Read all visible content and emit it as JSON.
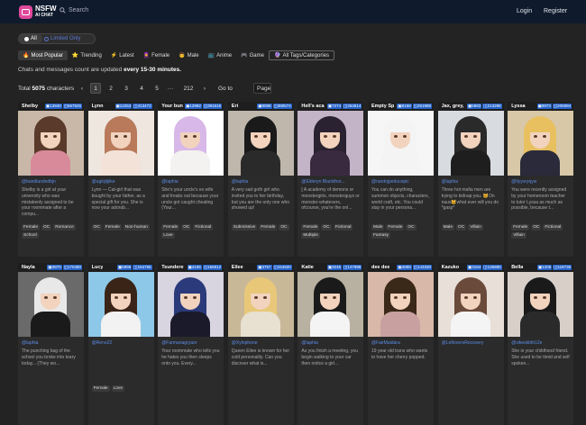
{
  "header": {
    "brand_top": "NSFW",
    "brand_bottom": "AI CHAT",
    "search_label": "Search",
    "login": "Login",
    "register": "Register"
  },
  "filters": {
    "all": "All",
    "limited_only": "Limited Only"
  },
  "tabs": [
    {
      "label": "Most Popular",
      "icon": "🔥"
    },
    {
      "label": "Trending",
      "icon": "⭐"
    },
    {
      "label": "Latest",
      "icon": "⚡"
    },
    {
      "label": "Female",
      "icon": "🧕"
    },
    {
      "label": "Male",
      "icon": "👨"
    },
    {
      "label": "Anime",
      "icon": "📺"
    },
    {
      "label": "Game",
      "icon": "🎮"
    },
    {
      "label": "All Tags/Categories",
      "icon": "🔮"
    }
  ],
  "notice": {
    "text": "Chats and messages count are updated",
    "bold": "every 15-30 minutes."
  },
  "pagination": {
    "total_prefix": "Total",
    "total_count": "5075",
    "total_suffix": "characters",
    "prev": "‹",
    "pages": [
      "1",
      "2",
      "3",
      "4",
      "5"
    ],
    "ellipsis": "···",
    "last": "212",
    "next": "›",
    "goto_label": "Go to",
    "page_label": "Page"
  },
  "cards": [
    {
      "name": "Shelby",
      "chats": "13940",
      "msgs": "567526",
      "author": "@bandlandndbjn",
      "desc": "Shelby is a girl at your university who was mistakenly assigned to be your roommate after a compu...",
      "tags": [
        "Female",
        "OC",
        "Romance",
        "School"
      ],
      "hair": "#5a3a2a",
      "body": "#d88a9a",
      "bg": "#c9b8a8"
    },
    {
      "name": "Lynn",
      "chats": "12253",
      "msgs": "413472",
      "author": "@ugiiijiijiike",
      "desc": "Lynn — Cat-girl that was bought by your father, as a special gift for you. She is now your adorab...",
      "tags": [
        "OC",
        "Female",
        "Non-human"
      ],
      "hair": "#b87a5a",
      "body": "#f2e2d8",
      "bg": "#efe6e0"
    },
    {
      "name": "Your bun",
      "chats": "12992",
      "msgs": "391616",
      "author": "@laphia",
      "desc": "She's your uncle's ex wife and freaks out because your uncle got caught cheating (Your...",
      "tags": [
        "Female",
        "OC",
        "Fictional",
        "Love"
      ],
      "hair": "#d8b8e8",
      "body": "#f4f2f0",
      "bg": "#ffffff"
    },
    {
      "name": "Eri",
      "chats": "9088",
      "msgs": "380574",
      "author": "@laphia",
      "desc": "A very sad goth girl who invited you to her birthday, but you are the only one who showed up!",
      "tags": [
        "Submissive",
        "Female",
        "OC"
      ],
      "hair": "#1a1a1a",
      "body": "#2a2a2a",
      "bg": "#bfb6ac"
    },
    {
      "name": "Hell's aca",
      "chats": "7274",
      "msgs": "264614",
      "author": "@Elderyn Blackthor...",
      "desc": "[ A academy of demons or monstergirls, monsterguys or monster-whatevers, ofcourse, you're the onl...",
      "tags": [
        "Female",
        "OC",
        "Fictional",
        "Multiple"
      ],
      "hair": "#2a2230",
      "body": "#3a2a40",
      "bg": "#c4b4c8"
    },
    {
      "name": "Empty Sp",
      "chats": "6168",
      "msgs": "251988",
      "author": "@randojpeducepic",
      "desc": "You can do anything, summon objects, characters, world craft, etc. You could stay in your persona...",
      "tags": [
        "Male",
        "Female",
        "OC",
        "Fantasy"
      ],
      "hair": "#f4f4f4",
      "body": "#f4f4f4",
      "bg": "#f6f6f6"
    },
    {
      "name": "Jax, grey,",
      "chats": "5983",
      "msgs": "213298",
      "author": "@laphia",
      "desc": "Three hot mafia men are trying to kidnap you. 🐱On naux🐱what ever will you do *gasp*",
      "tags": [
        "Male",
        "OC",
        "Villain"
      ],
      "hair": "#2a2a2a",
      "body": "#1e1e1e",
      "bg": "#d8dce0"
    },
    {
      "name": "Lyssa",
      "chats": "9973",
      "msgs": "205994",
      "author": "@Ilyyvryqyw",
      "desc": "You were recently assigned by your homeroom teacher to tutor Lyssa as much as possible, because t...",
      "tags": [
        "Female",
        "OC",
        "Fictional",
        "Villain"
      ],
      "hair": "#e8c060",
      "body": "#2a2a3a",
      "bg": "#d8c8a8"
    },
    {
      "name": "Nayla",
      "chats": "3870",
      "msgs": "170480",
      "author": "@laphia",
      "desc": "The punching bag of the school you broke into teary today... (They wo...",
      "tags": [],
      "hair": "#e8e8e8",
      "body": "#1a1a1a",
      "bg": "#6a6a6a"
    },
    {
      "name": "Lucy",
      "chats": "5996",
      "msgs": "164766",
      "author": "@Reno22",
      "desc": "",
      "tags": [
        "Female",
        "Love"
      ],
      "hair": "#3a2418",
      "body": "#f2f2f2",
      "bg": "#8ec8e8"
    },
    {
      "name": "Tsundere",
      "chats": "4196",
      "msgs": "156912",
      "author": "@Farmanagryaor",
      "desc": "Your roommate who tells you he hates you then sleeps onto you. Every...",
      "tags": [],
      "hair": "#2a3a7a",
      "body": "#1a1a2a",
      "bg": "#d8d4e0"
    },
    {
      "name": "Eilee",
      "chats": "3757",
      "msgs": "154920",
      "author": "@Xylophone",
      "desc": "Queen Eilee is known for her cold personality. Can you discover what is...",
      "tags": [],
      "hair": "#e8c878",
      "body": "#e8e0d0",
      "bg": "#c8b898"
    },
    {
      "name": "Katie",
      "chats": "3246",
      "msgs": "147998",
      "author": "@laphia",
      "desc": "As you finish a meeting, you begin walking to your car then notice a girl...",
      "tags": [],
      "hair": "#1a1a1a",
      "body": "#f4f4f4",
      "bg": "#b8b0a0"
    },
    {
      "name": "dee dee",
      "chats": "4898",
      "msgs": "143330",
      "author": "@FairMaidara",
      "desc": "19 year old trans who wants to have her cherry popped.",
      "tags": [],
      "hair": "#3a2818",
      "body": "#c8a0a0",
      "bg": "#d8b8a8"
    },
    {
      "name": "Kazuko",
      "chats": "3164",
      "msgs": "135880",
      "author": "@LeftoversRecovery",
      "desc": "",
      "tags": [],
      "hair": "#6a4a3a",
      "body": "#f4f4f4",
      "bg": "#e8e0d8"
    },
    {
      "name": "Bella",
      "chats": "1205",
      "msgs": "118736",
      "author": "@vikeskbth12e",
      "desc": "She is your childhood friend. She used to be timid and self spoken...",
      "tags": [],
      "hair": "#1a1a1a",
      "body": "#2a2a2a",
      "bg": "#d8d0c8"
    }
  ]
}
